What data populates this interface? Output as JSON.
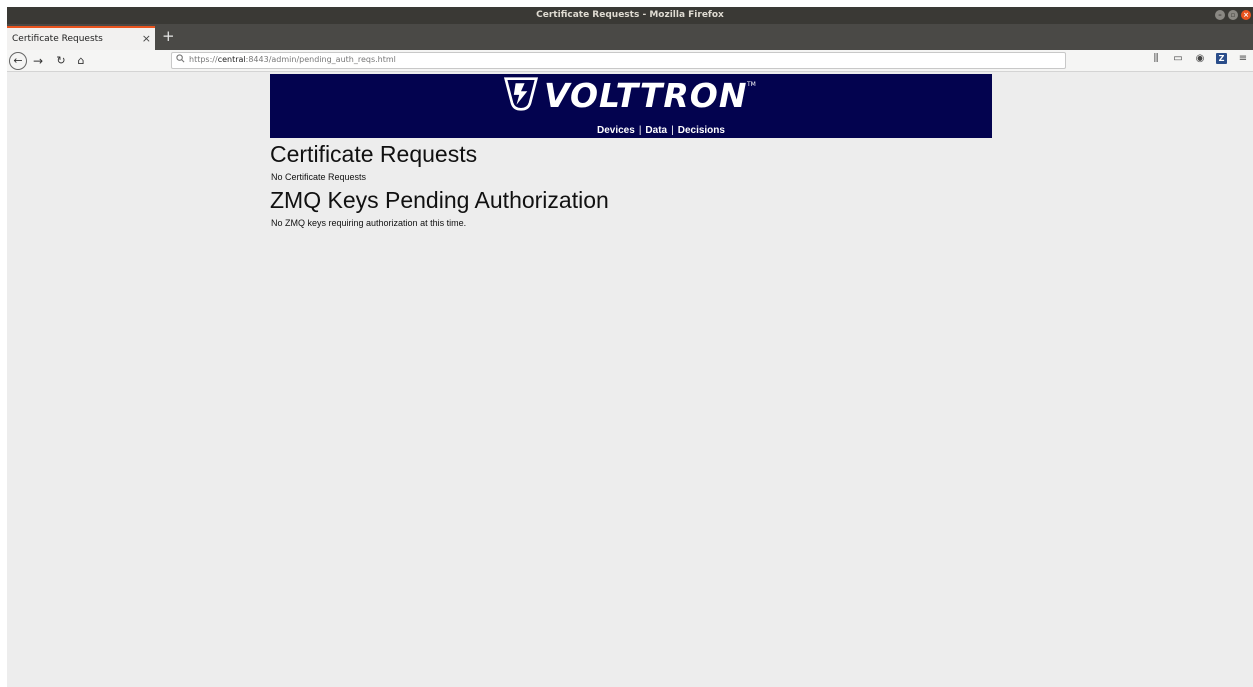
{
  "window": {
    "title": "Certificate Requests - Mozilla Firefox"
  },
  "tabs": [
    {
      "label": "Certificate Requests"
    }
  ],
  "navbar": {
    "url_prefix": "https://",
    "url_host": "central",
    "url_path": ":8443/admin/pending_auth_reqs.html"
  },
  "banner": {
    "logo_text": "VOLTTRON",
    "trademark": "TM",
    "tagline": {
      "devices": "Devices",
      "data": "Data",
      "decisions": "Decisions",
      "separator": "|"
    },
    "background_color": "#03034f"
  },
  "content": {
    "cert_heading": "Certificate Requests",
    "cert_text": "No Certificate Requests",
    "zmq_heading": "ZMQ Keys Pending Authorization",
    "zmq_text": "No ZMQ keys requiring authorization at this time."
  },
  "icons": {
    "back": "back-icon",
    "forward": "forward-icon",
    "reload": "reload-icon",
    "home": "home-icon",
    "search": "search-icon",
    "library": "library-icon",
    "sidebar": "sidebar-icon",
    "account": "account-icon",
    "zotero": "zotero-icon",
    "menu": "menu-icon"
  },
  "colors": {
    "accent": "#e9541f",
    "page_background": "#ededed"
  }
}
